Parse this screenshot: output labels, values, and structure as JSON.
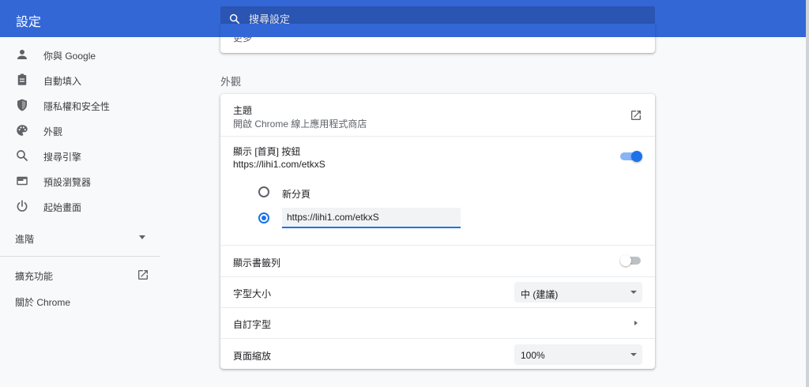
{
  "header": {
    "title": "設定",
    "search_placeholder": "搜尋設定"
  },
  "sidebar": {
    "items": [
      {
        "label": "你與 Google",
        "icon": "person-icon"
      },
      {
        "label": "自動填入",
        "icon": "clipboard-icon"
      },
      {
        "label": "隱私權和安全性",
        "icon": "shield-icon"
      },
      {
        "label": "外觀",
        "icon": "palette-icon"
      },
      {
        "label": "搜尋引擎",
        "icon": "search-icon"
      },
      {
        "label": "預設瀏覽器",
        "icon": "browser-icon"
      },
      {
        "label": "起始畫面",
        "icon": "power-icon"
      }
    ],
    "advanced_label": "進階",
    "extensions_label": "擴充功能",
    "about_label": "關於 Chrome"
  },
  "prev_card": {
    "label": "更多"
  },
  "appearance": {
    "section_title": "外觀",
    "theme": {
      "title": "主題",
      "subtitle": "開啟 Chrome 線上應用程式商店"
    },
    "home_button": {
      "title": "顯示 [首頁] 按鈕",
      "subtitle": "https://lihi1.com/etkxS",
      "enabled": true,
      "option_new_tab": "新分頁",
      "url_value": "https://lihi1.com/etkxS"
    },
    "bookmarks_bar": {
      "title": "顯示書籤列",
      "enabled": false
    },
    "font_size": {
      "label": "字型大小",
      "value": "中 (建議)"
    },
    "customize_fonts": {
      "label": "自訂字型"
    },
    "page_zoom": {
      "label": "頁面縮放",
      "value": "100%"
    }
  },
  "colors": {
    "header_bg": "#3367d6",
    "search_bg": "#2a55b3",
    "accent": "#1a73e8",
    "page_bg": "#f8f9fa"
  }
}
